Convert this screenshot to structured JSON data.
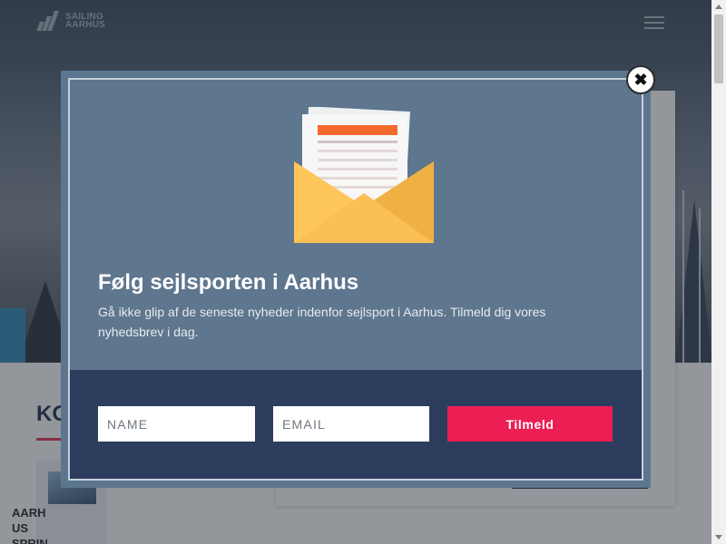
{
  "site": {
    "logo_line1": "SAILING",
    "logo_line2": "AARHUS",
    "menu_icon": "hamburger-icon"
  },
  "page": {
    "section_heading": "KO",
    "side_card_title": "AARH US SPRIN"
  },
  "popup": {
    "title": "Følg sejlsporten i Aarhus",
    "description": "Gå ikke glip af de seneste nyheder indenfor sejlsport i Aarhus. Tilmeld dig vores nyhedsbrev i dag.",
    "name_placeholder": "NAME",
    "email_placeholder": "EMAIL",
    "submit_label": "Tilmeld",
    "close_label": "✖",
    "illustration_icon": "envelope-newsletter-icon"
  },
  "colors": {
    "accent_red": "#ec1f55",
    "modal_bg": "#5e768e",
    "form_band": "#2c3d5e",
    "heading_navy": "#1e2d4a"
  }
}
